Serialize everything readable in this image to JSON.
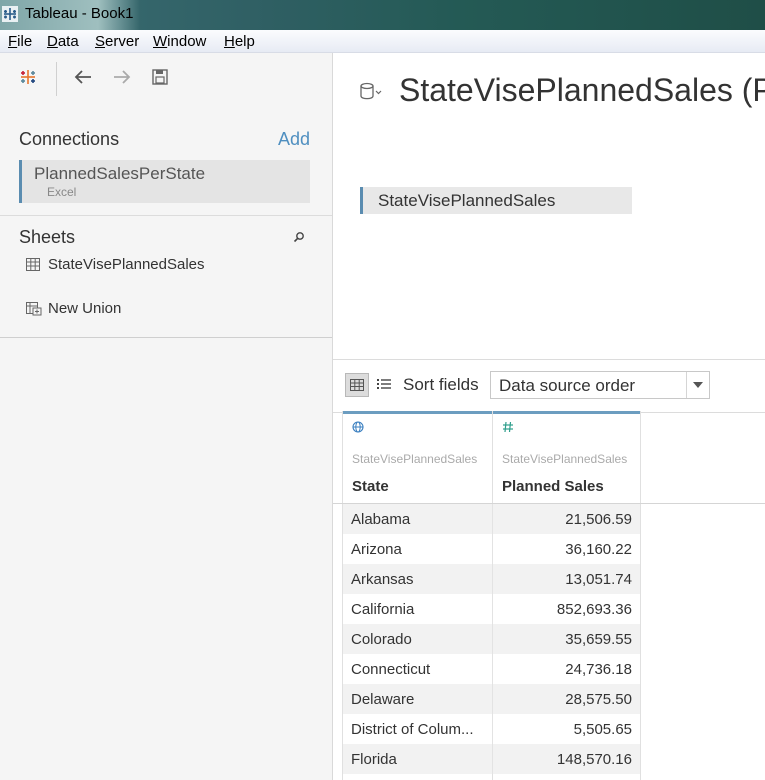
{
  "window": {
    "title": "Tableau - Book1"
  },
  "menu": [
    {
      "label": "File",
      "u": "F",
      "rest": "ile"
    },
    {
      "label": "Data",
      "u": "D",
      "rest": "ata"
    },
    {
      "label": "Server",
      "u": "S",
      "rest": "erver"
    },
    {
      "label": "Window",
      "u": "W",
      "rest": "indow"
    },
    {
      "label": "Help",
      "u": "H",
      "rest": "elp"
    }
  ],
  "connections": {
    "title": "Connections",
    "add_label": "Add",
    "items": [
      {
        "name": "PlannedSalesPerState",
        "type": "Excel"
      }
    ]
  },
  "sheets": {
    "title": "Sheets",
    "items": [
      {
        "label": "StateVisePlannedSales",
        "icon": "table-icon"
      },
      {
        "label": "New Union",
        "icon": "union-icon"
      }
    ]
  },
  "datasource": {
    "title": "StateVisePlannedSales (Pl",
    "canvas_table": "StateVisePlannedSales"
  },
  "grid": {
    "sort_label": "Sort fields",
    "sort_value": "Data source order",
    "columns": [
      {
        "type_icon": "globe-icon",
        "source": "StateVisePlannedSales",
        "name": "State"
      },
      {
        "type_icon": "number-icon",
        "source": "StateVisePlannedSales",
        "name": "Planned Sales"
      }
    ],
    "rows": [
      {
        "state": "Alabama",
        "sales": "21,506.59"
      },
      {
        "state": "Arizona",
        "sales": "36,160.22"
      },
      {
        "state": "Arkansas",
        "sales": "13,051.74"
      },
      {
        "state": "California",
        "sales": "852,693.36"
      },
      {
        "state": "Colorado",
        "sales": "35,659.55"
      },
      {
        "state": "Connecticut",
        "sales": "24,736.18"
      },
      {
        "state": "Delaware",
        "sales": "28,575.50"
      },
      {
        "state": "District of Colum...",
        "sales": "5,505.65"
      },
      {
        "state": "Florida",
        "sales": "148,570.16"
      }
    ]
  },
  "colors": {
    "accent": "#4f8fc0",
    "header_bar": "#6c9dc0",
    "number_icon": "#2e9e8c"
  }
}
